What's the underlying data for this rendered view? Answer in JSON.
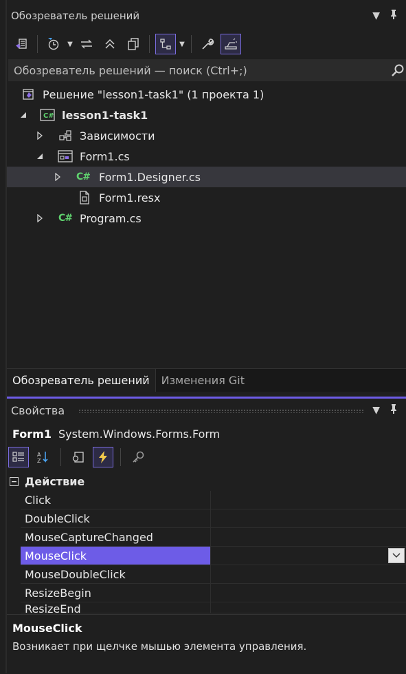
{
  "solution_explorer": {
    "title": "Обозреватель решений",
    "search_placeholder": "Обозреватель решений — поиск (Ctrl+;)",
    "solution_label": "Решение \"lesson1-task1\"  (1 проекта 1)",
    "project": "lesson1-task1",
    "items": {
      "dependencies": "Зависимости",
      "form1": "Form1.cs",
      "form1_designer": "Form1.Designer.cs",
      "form1_resx": "Form1.resx",
      "program": "Program.cs"
    },
    "cs_icon": "C#",
    "tabs": {
      "solution_explorer": "Обозреватель решений",
      "git_changes": "Изменения Git"
    }
  },
  "properties": {
    "title": "Свойства",
    "object_name": "Form1",
    "object_type": "System.Windows.Forms.Form",
    "category": "Действие",
    "collapse_glyph": "−",
    "rows": [
      "Click",
      "DoubleClick",
      "MouseCaptureChanged",
      "MouseClick",
      "MouseDoubleClick",
      "ResizeBegin",
      "ResizeEnd"
    ],
    "selected_row": "MouseClick",
    "description_title": "MouseClick",
    "description_text": "Возникает при щелчке мышью элемента управления."
  },
  "colors": {
    "accent": "#6d5ce7",
    "csharp": "#5fd16e",
    "background": "#1f1f1f"
  }
}
